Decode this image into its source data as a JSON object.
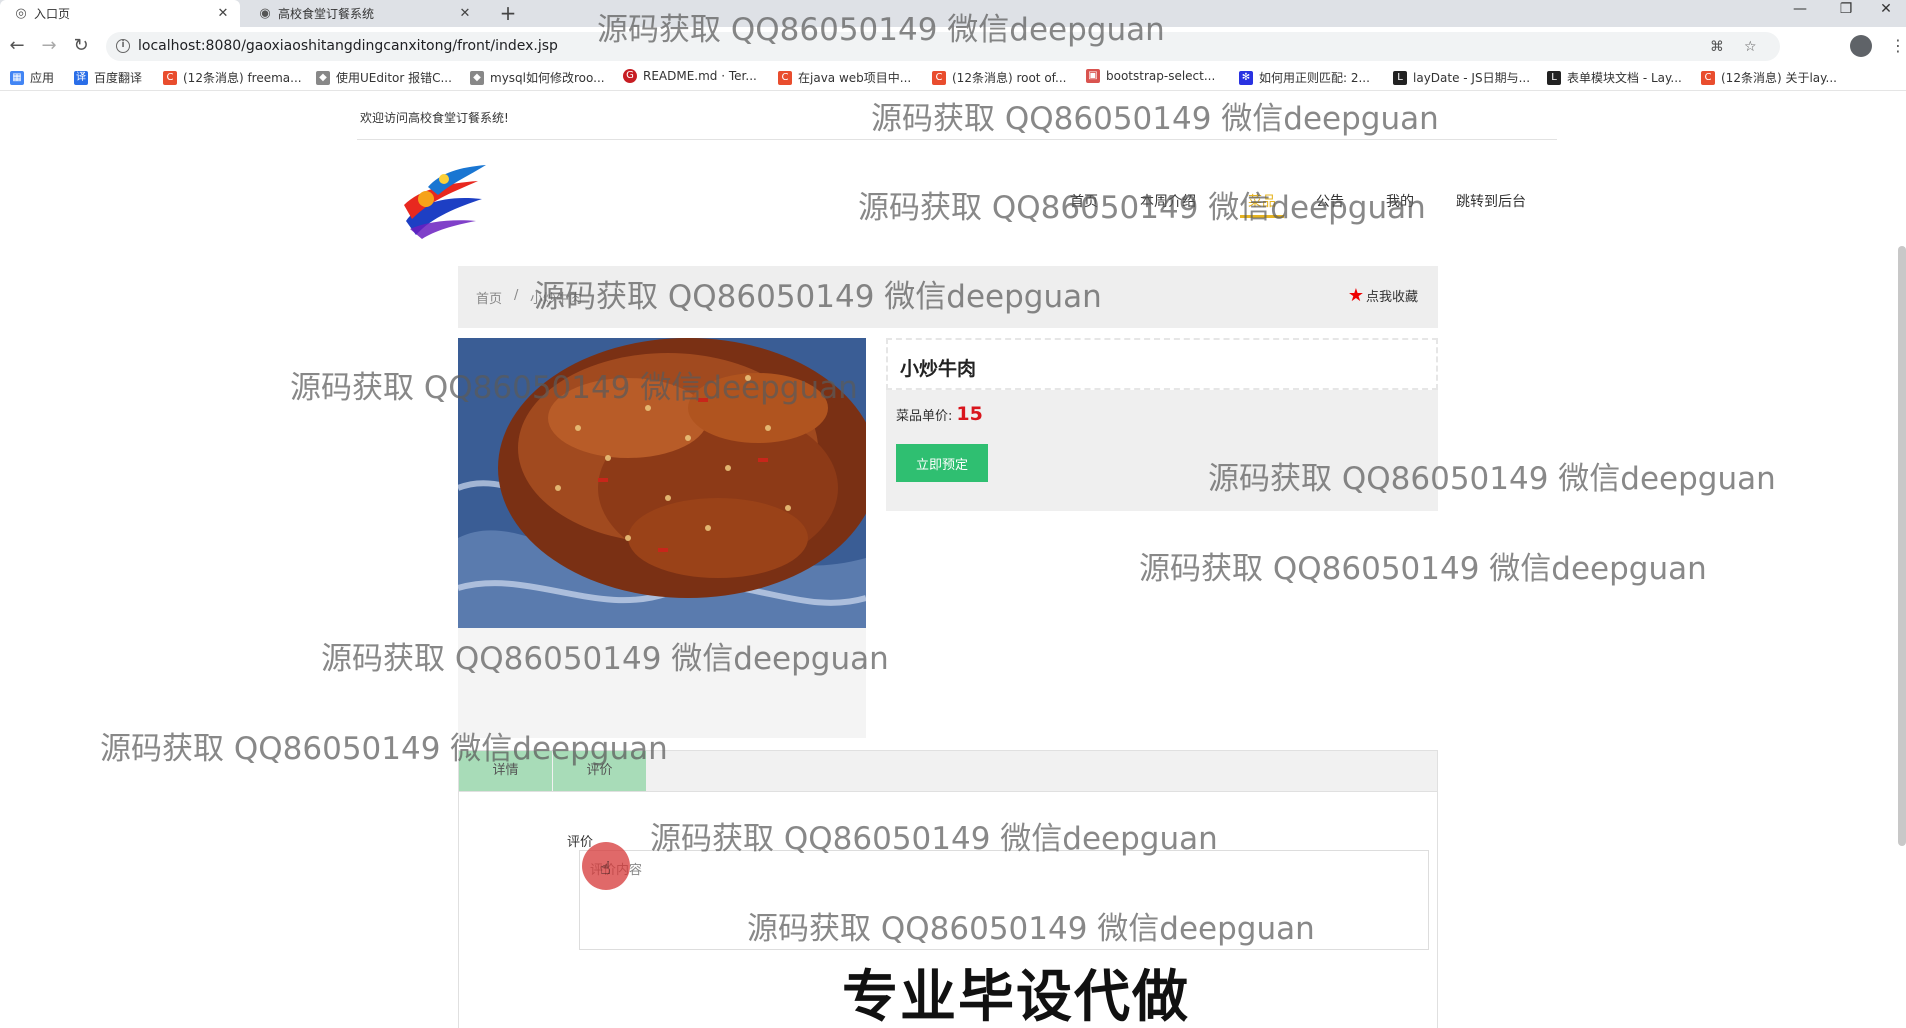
{
  "browser": {
    "tabs": [
      {
        "label": "入口页",
        "active": true
      },
      {
        "label": "高校食堂订餐系统",
        "active": false
      }
    ],
    "url": "localhost:8080/gaoxiaoshitangdingcanxitong/front/index.jsp",
    "bookmarks": [
      {
        "label": "应用",
        "icon": "apps-grid-icon"
      },
      {
        "label": "百度翻译",
        "icon": "baidu-translate-icon"
      },
      {
        "label": "(12条消息) freema...",
        "icon": "csdn-icon"
      },
      {
        "label": "使用UEditor 报错C...",
        "icon": "page-icon"
      },
      {
        "label": "mysql如何修改roo...",
        "icon": "page-icon"
      },
      {
        "label": "README.md · Ter...",
        "icon": "gitee-icon"
      },
      {
        "label": "在java web项目中...",
        "icon": "csdn-icon"
      },
      {
        "label": "(12条消息) root of...",
        "icon": "csdn-icon"
      },
      {
        "label": "bootstrap-select...",
        "icon": "page-icon"
      },
      {
        "label": "如何用正则匹配: 2...",
        "icon": "baidu-icon"
      },
      {
        "label": "layDate - JS日期与...",
        "icon": "layui-icon"
      },
      {
        "label": "表单模块文档 - Lay...",
        "icon": "layui-icon"
      },
      {
        "label": "(12条消息) 关于lay...",
        "icon": "csdn-icon"
      }
    ]
  },
  "site": {
    "welcome": "欢迎访问高校食堂订餐系统!",
    "nav": [
      "首页",
      "本周介绍",
      "菜品",
      "公告",
      "我的",
      "跳转到后台"
    ],
    "active_nav": "菜品"
  },
  "breadcrumb": {
    "home": "首页",
    "sep": "/",
    "current": "小炒牛肉"
  },
  "favorite_label": "点我收藏",
  "dish": {
    "name": "小炒牛肉",
    "price_label": "菜品单价:",
    "price": "15",
    "order_button": "立即预定"
  },
  "tabs": {
    "detail": "详情",
    "review": "评价"
  },
  "review": {
    "label": "评价",
    "placeholder": "评价内容"
  },
  "watermark_text": "源码获取 QQ86050149 微信deepguan",
  "banner_text": "专业毕设代做",
  "colors": {
    "accent_green": "#2fbf71",
    "nav_active": "#e6b422",
    "price_red": "#d9151d"
  }
}
